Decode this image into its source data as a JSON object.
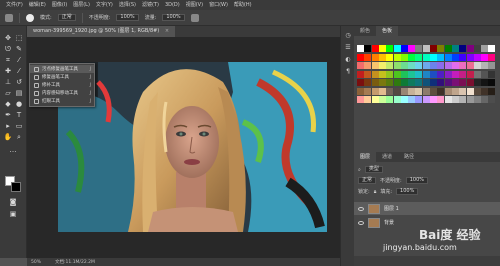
{
  "menu": [
    "文件(F)",
    "编辑(E)",
    "图像(I)",
    "图层(L)",
    "文字(Y)",
    "选择(S)",
    "滤镜(T)",
    "3D(D)",
    "视图(V)",
    "窗口(W)",
    "帮助(H)"
  ],
  "options": {
    "mode_label": "模式:",
    "mode_value": "正常",
    "opacity_label": "不透明度:",
    "opacity_value": "100%",
    "flow_label": "流量:",
    "flow_value": "100%"
  },
  "document": {
    "tab_title": "woman-399569_1920.jpg @ 50% (图层 1, RGB/8#)",
    "close": "×"
  },
  "flyout": [
    {
      "label": "污点修复画笔工具",
      "key": "J",
      "active": true
    },
    {
      "label": "修复画笔工具",
      "key": "J",
      "active": false
    },
    {
      "label": "修补工具",
      "key": "J",
      "active": false
    },
    {
      "label": "内容感知移动工具",
      "key": "J",
      "active": false
    },
    {
      "label": "红眼工具",
      "key": "J",
      "active": false
    }
  ],
  "status": {
    "zoom": "50%",
    "doc": "文档:11.1M/22.2M"
  },
  "panels": {
    "top_tabs": [
      "颜色",
      "色板"
    ],
    "layer_tabs": [
      "图层",
      "通道",
      "路径"
    ],
    "kind_label": "类型",
    "blend_mode": "正常",
    "opacity_label": "不透明度:",
    "opacity_value": "100%",
    "lock_label": "锁定:",
    "fill_label": "填充:",
    "fill_value": "100%",
    "layers": [
      {
        "name": "图层 1",
        "selected": true
      },
      {
        "name": "背景",
        "selected": false
      }
    ]
  },
  "swatch_colors": [
    [
      "#ffffff",
      "#000000",
      "#ff0000",
      "#ffff00",
      "#00ff00",
      "#00ffff",
      "#0000ff",
      "#ff00ff",
      "#808080",
      "#c0c0c0",
      "#800000",
      "#808000",
      "#008000",
      "#008080",
      "#000080",
      "#800080",
      "#404040",
      "#a0a0a0",
      "#ffffff"
    ],
    [
      "#ff0000",
      "#ff4000",
      "#ff8000",
      "#ffbf00",
      "#ffff00",
      "#bfff00",
      "#80ff00",
      "#00ff40",
      "#00ff80",
      "#00ffbf",
      "#00ffff",
      "#00bfff",
      "#0080ff",
      "#0040ff",
      "#4000ff",
      "#8000ff",
      "#bf00ff",
      "#ff00ff",
      "#ff0080"
    ],
    [
      "#f26c6c",
      "#f59a6c",
      "#f7c46c",
      "#f4ef6c",
      "#c3ea6c",
      "#8fe06c",
      "#6cdc90",
      "#6cdcc2",
      "#6cd2ec",
      "#6caaec",
      "#6c82ec",
      "#8a6cec",
      "#b66cec",
      "#e06cec",
      "#ec6cc0",
      "#ec6c94",
      "#d4d4d4",
      "#b4b4b4",
      "#949494"
    ],
    [
      "#c41e1e",
      "#c4581e",
      "#c4901e",
      "#c4c01e",
      "#8ec41e",
      "#4ec41e",
      "#1ec45a",
      "#1ec496",
      "#1ebcc4",
      "#1e86c4",
      "#1e4ec4",
      "#501ec4",
      "#8a1ec4",
      "#c41ebc",
      "#c41e86",
      "#c41e4e",
      "#747474",
      "#545454",
      "#343434"
    ],
    [
      "#7a0f0f",
      "#7a370f",
      "#7a5c0f",
      "#7a780f",
      "#587a0f",
      "#2f7a0f",
      "#0f7a36",
      "#0f7a5e",
      "#0f757a",
      "#0f537a",
      "#0f2f7a",
      "#310f7a",
      "#560f7a",
      "#7a0f75",
      "#7a0f53",
      "#7a0f2f",
      "#242424",
      "#141414",
      "#0a0a0a"
    ],
    [
      "#8c6239",
      "#a67c52",
      "#c69c6d",
      "#e2bc8f",
      "#736357",
      "#534741",
      "#998675",
      "#c7b299",
      "#d9c7ab",
      "#8c7b6b",
      "#5e4e3f",
      "#3e3128",
      "#a68b73",
      "#bfa58c",
      "#d9c3ae",
      "#f2e1cf",
      "#594a3d",
      "#403228",
      "#261e17"
    ],
    [
      "#ff9999",
      "#ffcc99",
      "#ffff99",
      "#ccff99",
      "#99ff99",
      "#99ffcc",
      "#99ffff",
      "#99ccff",
      "#9999ff",
      "#cc99ff",
      "#ff99ff",
      "#ff99cc",
      "#e6e6e6",
      "#cccccc",
      "#b3b3b3",
      "#999999",
      "#808080",
      "#666666",
      "#4d4d4d"
    ]
  ],
  "watermark": {
    "top": "Bai度 经验",
    "bottom": "jingyan.baidu.com"
  }
}
